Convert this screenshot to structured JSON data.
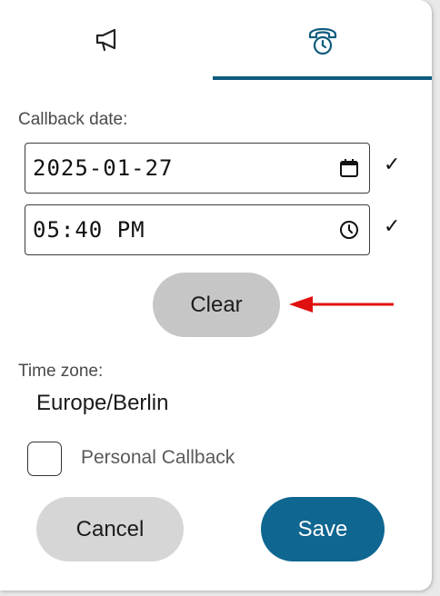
{
  "tabs": [
    {
      "icon": "megaphone-icon",
      "active": false
    },
    {
      "icon": "phone-clock-icon",
      "active": true
    }
  ],
  "callback": {
    "date_label": "Callback date:",
    "date_value": "2025-01-27",
    "time_value": "05:40  PM",
    "date_check": "✓",
    "time_check": "✓"
  },
  "buttons": {
    "clear": "Clear",
    "cancel": "Cancel",
    "save": "Save"
  },
  "timezone": {
    "label": "Time zone:",
    "value": "Europe/Berlin"
  },
  "personal_callback": {
    "label": "Personal Callback",
    "checked": false
  },
  "colors": {
    "accent": "#0f5b7e",
    "save_button": "#0f6690",
    "clear_button": "#c6c6c6",
    "annotation_arrow": "#e01010"
  }
}
